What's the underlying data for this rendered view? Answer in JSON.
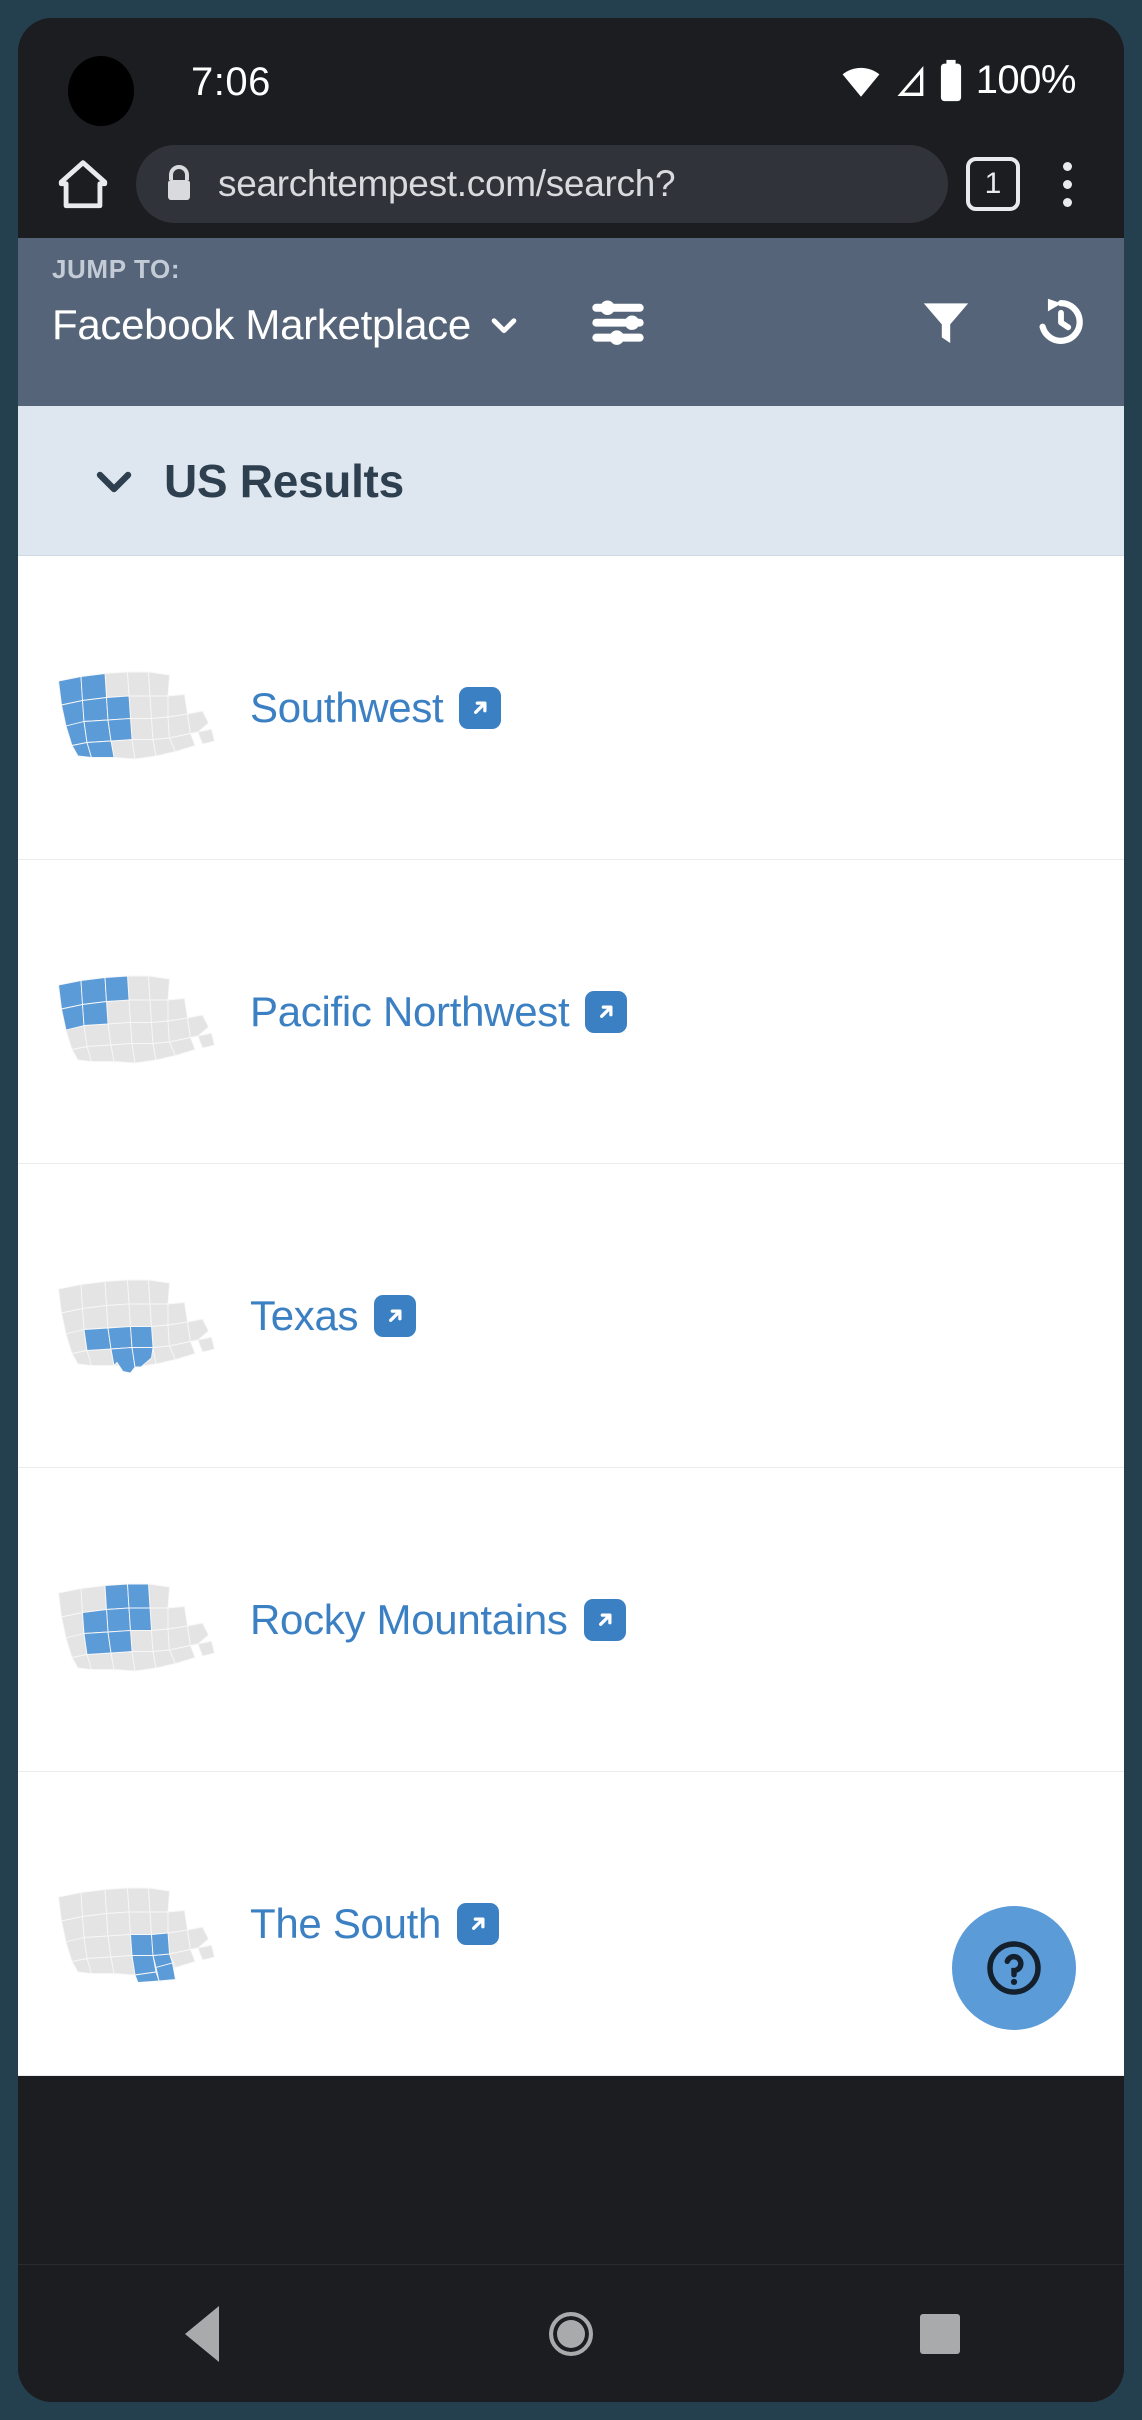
{
  "status_bar": {
    "time": "7:06",
    "battery_percent": "100%",
    "icons": [
      "wifi-icon",
      "signal-icon",
      "battery-icon"
    ]
  },
  "browser": {
    "home_icon": "home-icon",
    "lock_icon": "lock-icon",
    "url": "searchtempest.com/search?",
    "tab_count": "1",
    "overflow_icon": "overflow-menu-icon"
  },
  "jump_toolbar": {
    "label": "JUMP TO:",
    "selected_site": "Facebook Marketplace",
    "chevron_icon": "chevron-down-icon",
    "sliders_icon": "sliders-icon",
    "filter_icon": "filter-icon",
    "history_icon": "history-icon"
  },
  "results_header": {
    "title": "US Results",
    "chevron_icon": "chevron-down-icon"
  },
  "regions": [
    {
      "label": "Southwest",
      "map_icon": "us-map-southwest",
      "link_icon": "external-link-icon"
    },
    {
      "label": "Pacific Northwest",
      "map_icon": "us-map-pacific-northwest",
      "link_icon": "external-link-icon"
    },
    {
      "label": "Texas",
      "map_icon": "us-map-texas",
      "link_icon": "external-link-icon"
    },
    {
      "label": "Rocky Mountains",
      "map_icon": "us-map-rocky-mountains",
      "link_icon": "external-link-icon"
    },
    {
      "label": "The South",
      "map_icon": "us-map-the-south",
      "link_icon": "external-link-icon"
    }
  ],
  "help_button": {
    "icon": "help-circle-icon"
  },
  "nav_bar": {
    "back": "back-triangle-icon",
    "home": "home-circle-icon",
    "recents": "recents-square-icon"
  },
  "colors": {
    "accent_blue": "#3c80c4",
    "map_highlight": "#5b9bd8",
    "map_base": "#e4e4e4",
    "toolbar_slate": "#566479",
    "results_header_bg": "#dee7ef",
    "chrome_dark": "#1c1d21"
  }
}
